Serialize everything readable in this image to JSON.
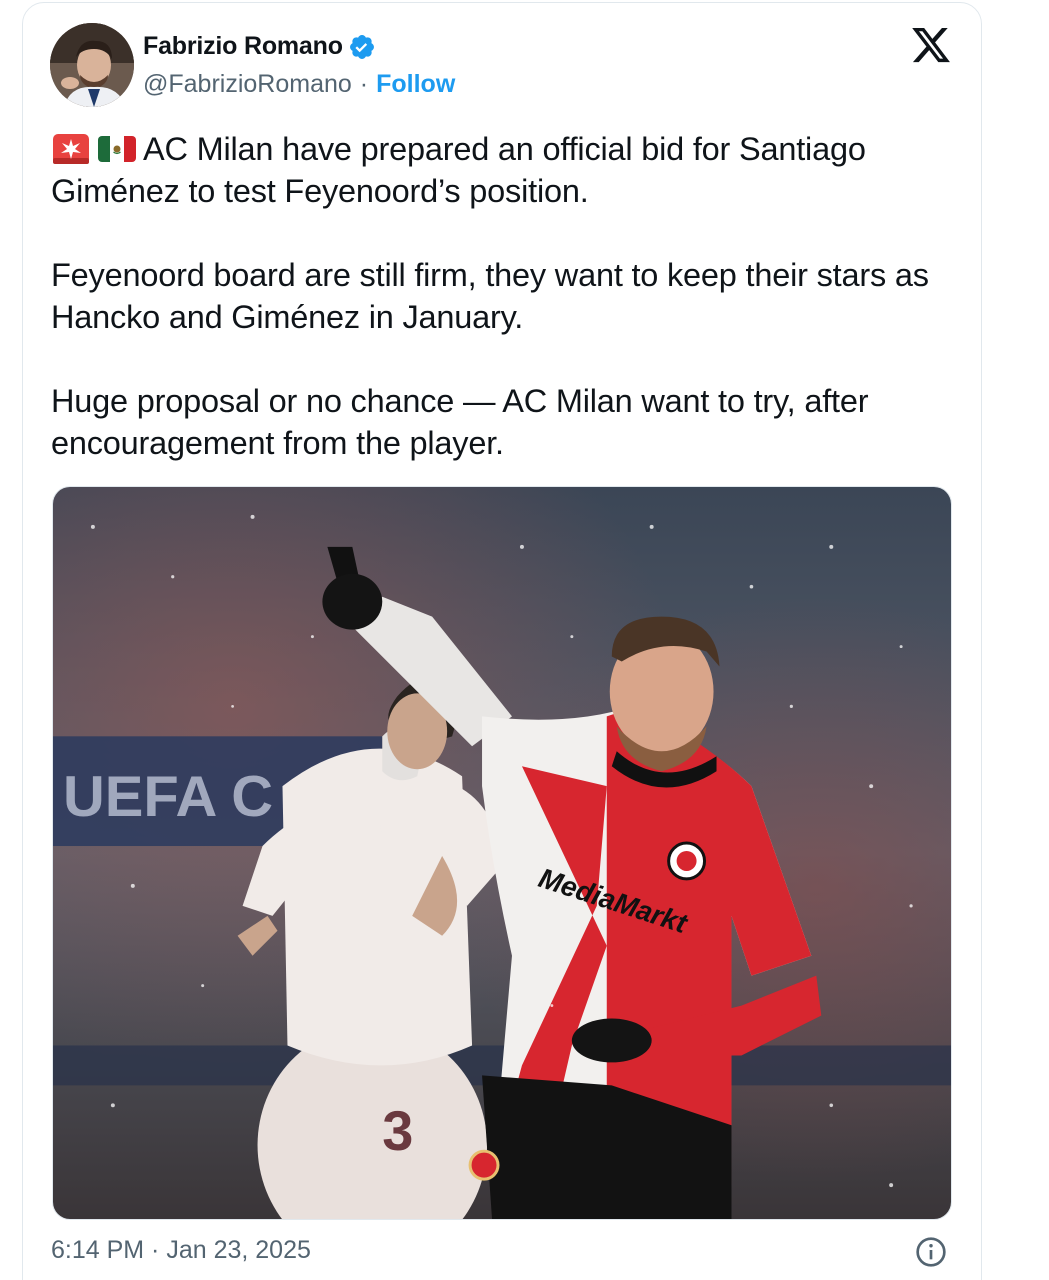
{
  "author": {
    "display_name": "Fabrizio Romano",
    "handle": "@FabrizioRomano",
    "separator": "·",
    "follow_label": "Follow"
  },
  "icons": {
    "verified": "verified-badge-icon",
    "platform": "x-logo-icon",
    "info": "info-icon",
    "emoji_1": "rotating-light-emoji",
    "emoji_2": "mexico-flag-emoji"
  },
  "tweet": {
    "paragraph_1": "AC Milan have prepared an official bid for Santiago Giménez to test Feyenoord’s position.",
    "paragraph_2": "Feyenoord board are still firm, they want to keep their stars as Hancko and Giménez in January.",
    "paragraph_3": "Huge proposal or no chance — AC Milan want to try, after encouragement from the player."
  },
  "media": {
    "sponsor_text": "MediaMarkt",
    "shirt_number": "3",
    "banner_text": "UEFA C"
  },
  "footer": {
    "timestamp": "6:14 PM · Jan 23, 2025"
  },
  "colors": {
    "link": "#1d9bf0",
    "secondary_text": "#536471",
    "feyenoord_red": "#d7262f"
  }
}
